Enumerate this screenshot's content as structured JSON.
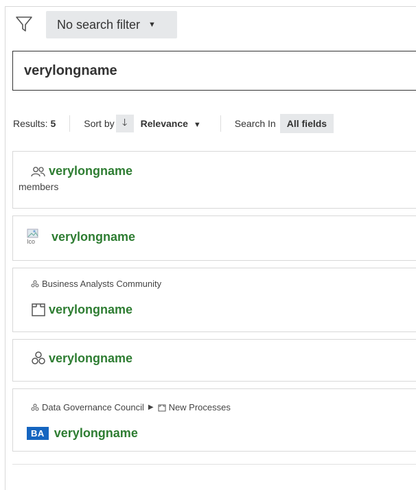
{
  "filter": {
    "label": "No search filter",
    "icon": "funnel-icon"
  },
  "search": {
    "value": "verylongname"
  },
  "toolbar": {
    "results_label": "Results:",
    "results_count": "5",
    "sort_label": "Sort by",
    "sort_value": "Relevance",
    "search_in_label": "Search In",
    "search_in_value": "All fields"
  },
  "results": [
    {
      "title": "verylongname",
      "subtitle": "members",
      "icon": "users-icon"
    },
    {
      "title": "verylongname",
      "image_alt": "Ico",
      "icon": "broken-image-icon"
    },
    {
      "crumb": "Business Analysts Community",
      "title": "verylongname",
      "icon": "domain-box-icon"
    },
    {
      "title": "verylongname",
      "icon": "community-icon"
    },
    {
      "crumb_1": "Data Governance Council",
      "crumb_2": "New Processes",
      "badge": "BA",
      "title": "verylongname"
    }
  ]
}
